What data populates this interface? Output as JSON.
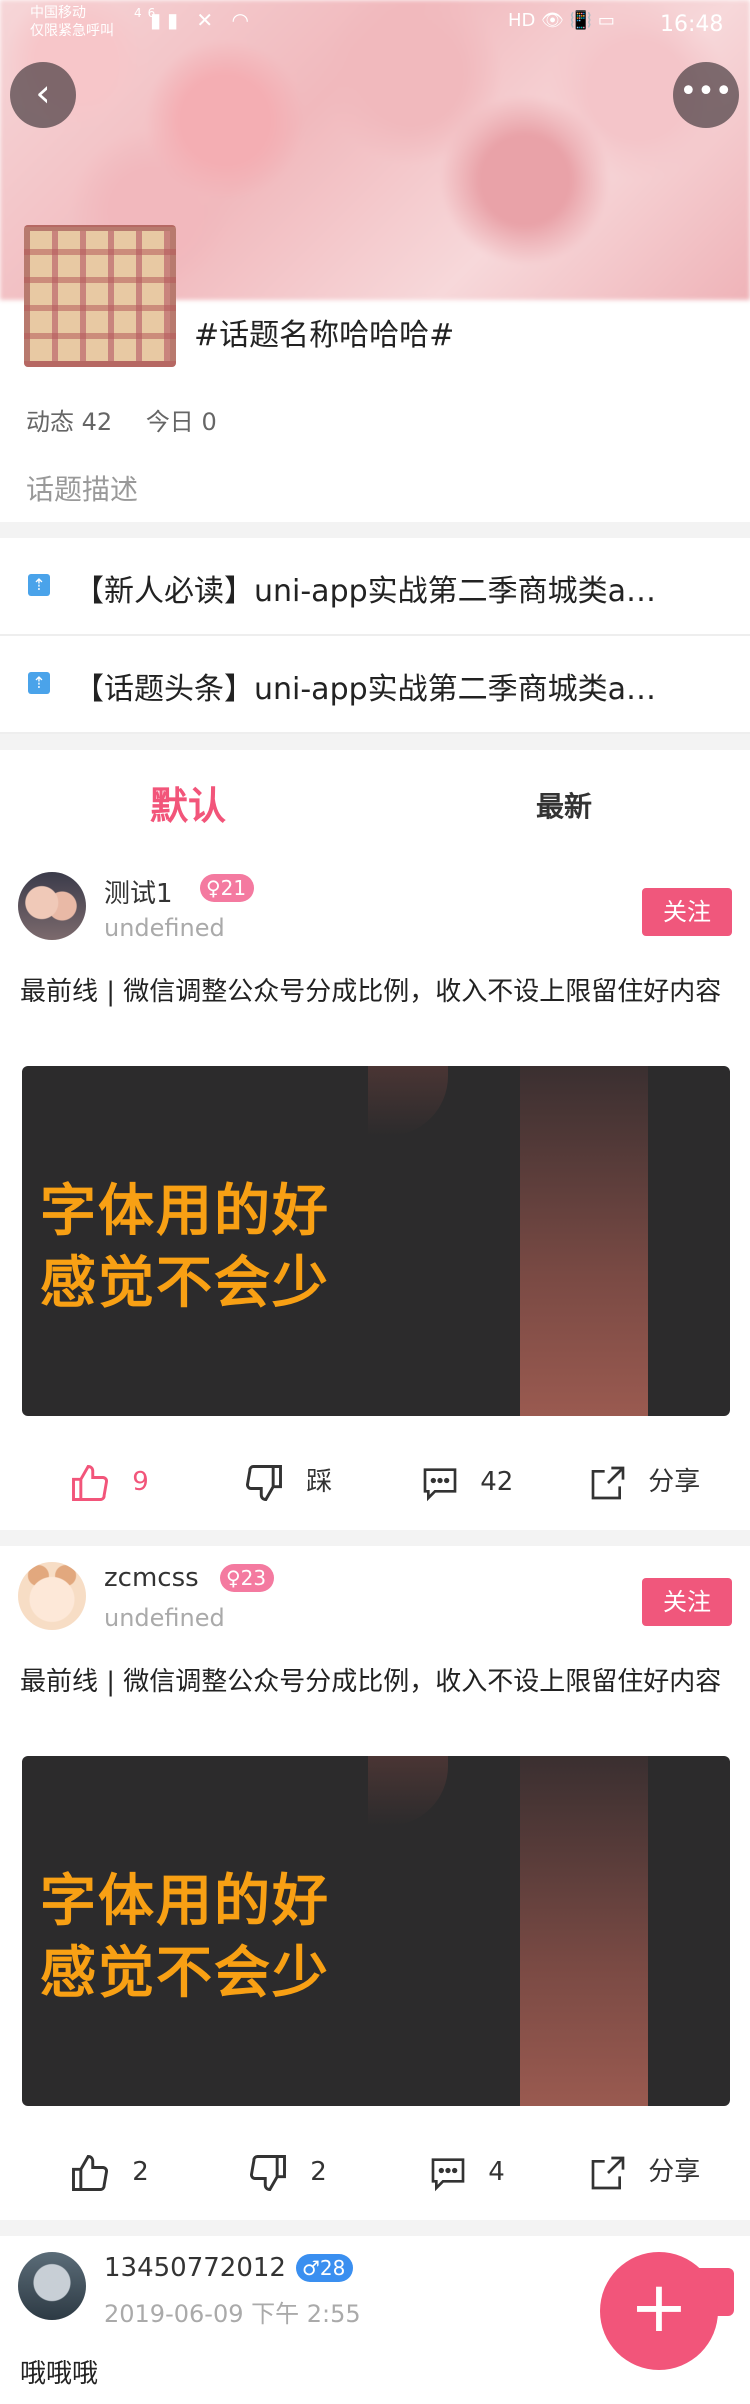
{
  "status_bar": {
    "carrier_line1": "中国移动",
    "carrier_line2": "仅限紧急呼叫",
    "network": "46",
    "time": "16:48",
    "right_icons": "HD 👁 📳 ▭"
  },
  "topic": {
    "title": "#话题名称哈哈哈#",
    "dynamics": "动态 42",
    "today": "今日 0",
    "description": "话题描述"
  },
  "notices": [
    {
      "text": "【新人必读】uni-app实战第二季商城类a…"
    },
    {
      "text": "【话题头条】uni-app实战第二季商城类a…"
    }
  ],
  "tabs": {
    "default": "默认",
    "newest": "最新"
  },
  "posts": [
    {
      "username": "测试1",
      "badge": "♀21",
      "subtitle": "undefined",
      "follow": "关注",
      "text": "最前线 | 微信调整公众号分成比例，收入不设上限留住好内容",
      "image_text_1": "字体用的好",
      "image_text_2": "感觉不会少",
      "like_count": "9",
      "dislike_label": "踩",
      "comment_count": "42",
      "share_label": "分享"
    },
    {
      "username": "zcmcss",
      "badge": "♀23",
      "subtitle": "undefined",
      "follow": "关注",
      "text": "最前线 | 微信调整公众号分成比例，收入不设上限留住好内容",
      "image_text_1": "字体用的好",
      "image_text_2": "感觉不会少",
      "like_count": "2",
      "dislike_label": "2",
      "comment_count": "4",
      "share_label": "分享"
    },
    {
      "username": "13450772012",
      "badge": "♂28",
      "subtitle": "2019-06-09 下午 2:55",
      "text": "哦哦哦"
    }
  ],
  "fab": {
    "label": "+"
  },
  "colors": {
    "accent": "#f2557a",
    "badge_female": "#f47aa0",
    "badge_male": "#3a8ff0",
    "pin": "#4aa3ea"
  }
}
